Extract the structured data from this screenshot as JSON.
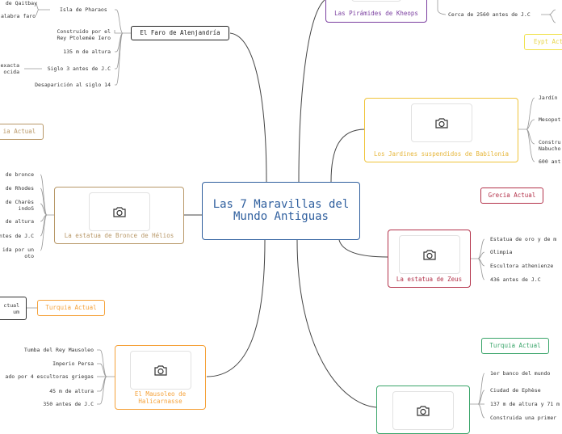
{
  "central": {
    "title": "Las 7 Maravillas del Mundo Antiguas"
  },
  "pyramids": {
    "title": "Las Pirámides de Kheops",
    "detail": "Cerca de 2560 antes de J.C"
  },
  "lighthouse": {
    "title": "El Faro de Alenjandría",
    "details": [
      "de Qaitbay",
      "Isla de Pharaos",
      "alabra faro",
      "Construido por el\nRey Ptolemée Iero",
      "135 m de altura",
      "Siglo 3 antes de J.C",
      "exacta\nocida",
      "Desaparición al siglo 14"
    ]
  },
  "gardens": {
    "title": "Los Jardines suspendidos de Babilonia",
    "details": [
      "Jardín",
      "Mesopot",
      "Constru\nNabucho",
      "600 ant"
    ]
  },
  "colossus": {
    "title": "La estatua de Bronce de Hélios",
    "details": [
      "de bronce",
      "de Rhodes",
      "de Charès\nindoS",
      "de altura",
      "ntes de J.C",
      "ida por un\noto"
    ]
  },
  "zeus": {
    "title": "La estatua de Zeus",
    "details": [
      "Estatua de oro y de m",
      "Olimpia",
      "Escultora athenienze",
      "436 antes de J.C"
    ]
  },
  "mausoleum": {
    "title": "El Mausoleo de Halicarnasse",
    "details": [
      "Tumba del Rey Mausoleo",
      "Imperio Persa",
      "ado por 4 escultoras griegas",
      "45 m de altura",
      "350 antes de J.C"
    ]
  },
  "artemis": {
    "details": [
      "1er banco del mundo",
      "Ciudad de Ephèse",
      "137 m de altura y 71 m",
      "Construida una primer"
    ]
  },
  "tags": {
    "egypt_partial": "Eypt Act",
    "greece_left": "ia Actual",
    "greece": "Grecia Actual",
    "turkey_left": "Turquia Actual",
    "turkey_right": "Turquia Actual",
    "bodrum_partial": "ctual\num"
  },
  "colors": {
    "central": "#2f5f9e",
    "pyramids": "#7b3fa0",
    "lighthouse": "#222222",
    "gardens": "#f0c43a",
    "colossus": "#b89868",
    "zeus": "#b3324a",
    "mausoleum": "#f5a23a",
    "artemis": "#3aa56a"
  }
}
